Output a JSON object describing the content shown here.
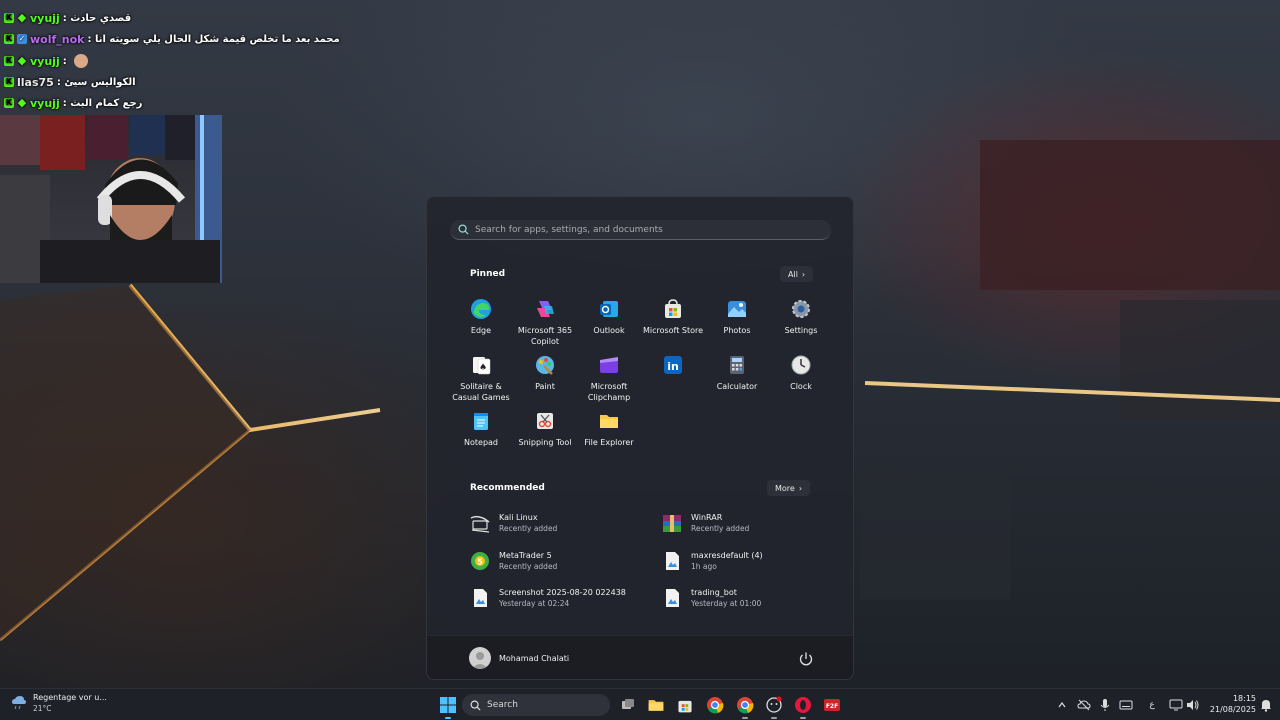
{
  "chat": [
    {
      "user": "vyujj",
      "message": ": قصدي حادث",
      "color": "#53fc18",
      "badges": [
        "k",
        "g"
      ]
    },
    {
      "user": "wolf_nok",
      "message": ": محمد بعد ما تخلص قيمة شكل الحال يلي سويته انا",
      "color": "#b86cf0",
      "badges": [
        "k",
        "b"
      ]
    },
    {
      "user": "vyujj",
      "message": ":",
      "color": "#53fc18",
      "badges": [
        "k",
        "g"
      ]
    },
    {
      "user": "llas75",
      "message": ": الكواليس سيئ",
      "color": "#e8e8e8",
      "badges": [
        "k"
      ]
    },
    {
      "user": "vyujj",
      "message": ": رجع كمام البث",
      "color": "#53fc18",
      "badges": [
        "k",
        "g"
      ]
    }
  ],
  "start_menu": {
    "search_placeholder": "Search for apps, settings, and documents",
    "pinned_title": "Pinned",
    "all_label": "All",
    "pinned": [
      {
        "label": "Edge",
        "icon": "edge-icon"
      },
      {
        "label": "Microsoft 365 Copilot",
        "icon": "m365-copilot-icon"
      },
      {
        "label": "Outlook",
        "icon": "outlook-icon"
      },
      {
        "label": "Microsoft Store",
        "icon": "store-icon"
      },
      {
        "label": "Photos",
        "icon": "photos-icon"
      },
      {
        "label": "Settings",
        "icon": "settings-icon"
      },
      {
        "label": "Solitaire & Casual Games",
        "icon": "solitaire-icon"
      },
      {
        "label": "Paint",
        "icon": "paint-icon"
      },
      {
        "label": "Microsoft Clipchamp",
        "icon": "clipchamp-icon"
      },
      {
        "label": "",
        "icon": "linkedin-icon"
      },
      {
        "label": "Calculator",
        "icon": "calculator-icon"
      },
      {
        "label": "Clock",
        "icon": "clock-icon"
      },
      {
        "label": "Notepad",
        "icon": "notepad-icon"
      },
      {
        "label": "Snipping Tool",
        "icon": "snipping-tool-icon"
      },
      {
        "label": "File Explorer",
        "icon": "file-explorer-icon"
      }
    ],
    "recommended_title": "Recommended",
    "more_label": "More",
    "recommended": [
      {
        "name": "Kali Linux",
        "sub": "Recently added",
        "icon": "kali-linux-icon"
      },
      {
        "name": "WinRAR",
        "sub": "Recently added",
        "icon": "winrar-icon"
      },
      {
        "name": "MetaTrader 5",
        "sub": "Recently added",
        "icon": "metatrader-icon"
      },
      {
        "name": "maxresdefault (4)",
        "sub": "1h ago",
        "icon": "image-file-icon"
      },
      {
        "name": "Screenshot 2025-08-20 022438",
        "sub": "Yesterday at 02:24",
        "icon": "image-file-icon"
      },
      {
        "name": "trading_bot",
        "sub": "Yesterday at 01:00",
        "icon": "image-file-icon"
      }
    ],
    "user_name": "Mohamad Chalati"
  },
  "taskbar": {
    "weather_title": "Regentage vor u...",
    "weather_temp": "21°C",
    "search_label": "Search",
    "tray_lang": "ع",
    "time": "18:15",
    "date": "21/08/2025"
  }
}
